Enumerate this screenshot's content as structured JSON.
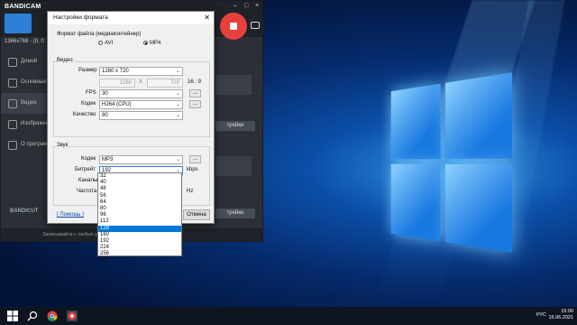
{
  "bandicam": {
    "logo": "BANDICAM",
    "size_text": "1366x768 - (0, 0",
    "sidebar": [
      "Домой",
      "Основные",
      "Видео",
      "Изображен",
      "О программ"
    ],
    "settings_btn": "тройки",
    "settings_btn2": "тройки",
    "bandicut": "BANDICUT",
    "footer": "Записывайте с любых устройств: смартфон, PS/Xbox",
    "cancel_btn": "Отмена"
  },
  "dialog": {
    "title": "Настройки формата",
    "container_label": "Формат файла (медиаконтейнер)",
    "avi": "AVI",
    "mp4": "MP4",
    "video_group": "Видео",
    "size_label": "Размер",
    "size_value": "1280 x 720",
    "width": "1280",
    "x": "X",
    "height": "720",
    "ratio": "16 : 9",
    "fps_label": "FPS",
    "fps_value": "30",
    "codec_label": "Кодек",
    "codec_value": "H264 (CPU)",
    "quality_label": "Качество",
    "quality_value": "80",
    "audio_group": "Звук",
    "acodec_label": "Кодек",
    "acodec_value": "MP3",
    "bitrate_label": "Битрейт",
    "bitrate_value": "192",
    "bitrate_unit": "kbps",
    "channels_label": "Каналы",
    "freq_label": "Частота",
    "freq_unit": "Hz",
    "dots": "...",
    "help_link": "[ Помощь ]",
    "bitrate_options": [
      "32",
      "40",
      "48",
      "56",
      "64",
      "80",
      "96",
      "112",
      "128",
      "160",
      "192",
      "224",
      "256",
      "320"
    ],
    "highlighted": "128"
  },
  "taskbar": {
    "lang": "РУС",
    "time": "15:00",
    "date": "15.06.2021"
  }
}
